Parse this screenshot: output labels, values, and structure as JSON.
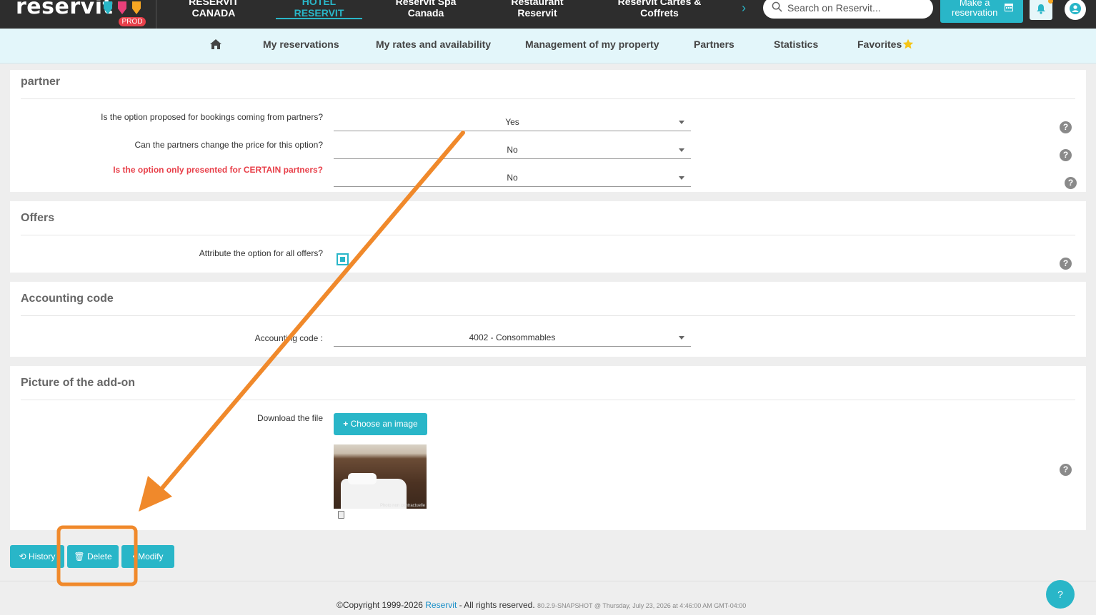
{
  "topbar": {
    "logo": "reservit",
    "env_badge": "PROD",
    "tabs": [
      {
        "label_line1": "RESERVIT",
        "label_line2": "CANADA"
      },
      {
        "label_line1": "HOTEL",
        "label_line2": "RESERVIT"
      },
      {
        "label_line1": "Reservit Spa",
        "label_line2": "Canada"
      },
      {
        "label_line1": "Restaurant",
        "label_line2": "Reservit"
      },
      {
        "label_line1": "Reservit Cartes &",
        "label_line2": "Coffrets"
      }
    ],
    "search_placeholder": "Search on Reservit...",
    "make_reservation_line1": "Make a",
    "make_reservation_line2": "reservation"
  },
  "subnav": {
    "items": [
      "My reservations",
      "My rates and availability",
      "Management of my property",
      "Partners",
      "Statistics",
      "Favorites"
    ]
  },
  "partner_panel": {
    "title": "partner",
    "rows": [
      {
        "question": "Is the option proposed for bookings coming from partners?",
        "value": "Yes"
      },
      {
        "question": "Can the partners change the price for this option?",
        "value": "No"
      },
      {
        "question": "Is the option only presented for CERTAIN partners?",
        "value": "No"
      }
    ]
  },
  "offers_panel": {
    "title": "Offers",
    "question": "Attribute the option for all offers?",
    "checked": true
  },
  "accounting_panel": {
    "title": "Accounting code",
    "label": "Accounting code :",
    "value": "4002 - Consommables"
  },
  "picture_panel": {
    "title": "Picture of the add-on",
    "label": "Download the file",
    "choose_button": "Choose an image",
    "thumb_caption": "Photo non contractuelle"
  },
  "actions": {
    "history": "History",
    "delete": "Delete",
    "modify": "Modify"
  },
  "footer": {
    "copyright": "©Copyright 1999-2026",
    "brand": "Reservit",
    "rights": "- All rights reserved.",
    "version": "80.2.9-SNAPSHOT @ Thursday, July 23, 2026 at 4:46:00 AM GMT-04:00"
  },
  "help_glyph": "?",
  "colors": {
    "accent": "#29b6c8",
    "topbar": "#2d2d2d",
    "annotation": "#f0892b",
    "warning_text": "#e8404a"
  }
}
